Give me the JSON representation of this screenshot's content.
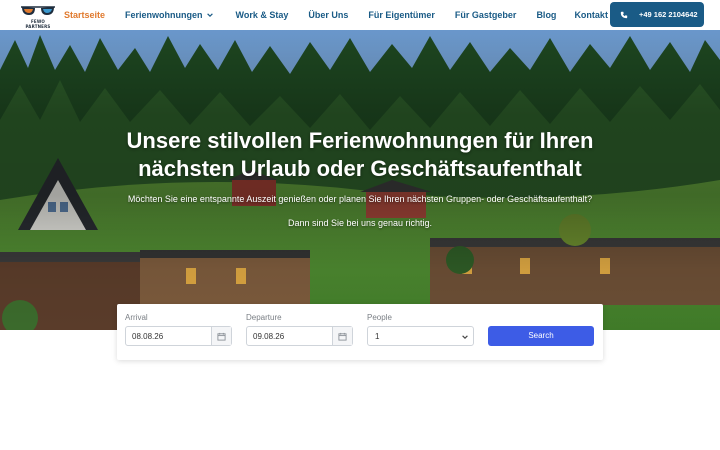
{
  "brand": {
    "logo_text": "FEWO PARTNERS",
    "icon": "sunglasses-logo-icon"
  },
  "nav": {
    "items": [
      {
        "label": "Startseite",
        "active": true
      },
      {
        "label": "Ferienwohnungen",
        "has_dropdown": true
      },
      {
        "label": "Work & Stay"
      },
      {
        "label": "Über Uns"
      },
      {
        "label": "Für Eigentümer"
      },
      {
        "label": "Für Gastgeber"
      },
      {
        "label": "Blog"
      },
      {
        "label": "Kontakt"
      }
    ],
    "phone": "+49 162 2104642",
    "phone_icon": "phone-icon"
  },
  "hero": {
    "title_line1": "Unsere stilvollen Ferienwohnungen für Ihren",
    "title_line2": "nächsten Urlaub oder Geschäftsaufenthalt",
    "subtitle": "Möchten Sie eine entspannte Auszeit genießen oder planen Sie Ihren nächsten Gruppen- oder Geschäftsaufenthalt?",
    "subtitle2": "Dann sind Sie bei uns genau richtig."
  },
  "booking": {
    "arrival_label": "Arrival",
    "arrival_value": "08.08.26",
    "departure_label": "Departure",
    "departure_value": "09.08.26",
    "people_label": "People",
    "people_value": "1",
    "search_label": "Search",
    "calendar_icon": "calendar-icon"
  },
  "colors": {
    "nav_text": "#1a5b86",
    "active": "#e07a2e",
    "phone_button": "#1a5b86",
    "search_button": "#3d5ce6"
  }
}
